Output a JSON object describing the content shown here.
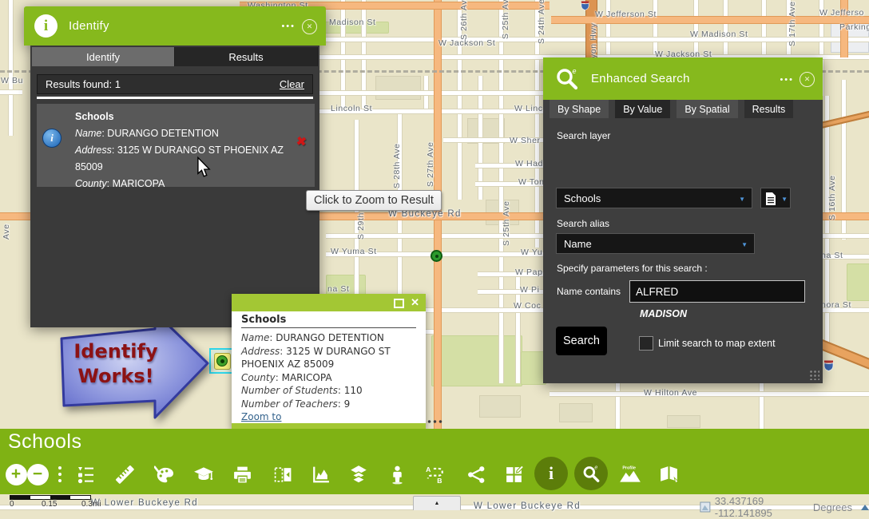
{
  "identify_panel": {
    "title": "Identify",
    "icon_glyph": "i",
    "menu_icon": "•••",
    "close_icon": "✕",
    "tabs": [
      "Identify",
      "Results"
    ],
    "active_tab": "Identify",
    "results_summary": "Results found: 1",
    "clear_label": "Clear",
    "result": {
      "layer": "Schools",
      "remove_icon": "✖",
      "info_glyph": "i",
      "fields": [
        {
          "name": "Name",
          "value": "DURANGO DETENTION"
        },
        {
          "name": "Address",
          "value": "3125 W DURANGO ST PHOENIX AZ 85009"
        },
        {
          "name": "County",
          "value": "MARICOPA"
        }
      ]
    }
  },
  "tooltip": {
    "text": "Click to Zoom to Result"
  },
  "search_panel": {
    "title": "Enhanced Search",
    "icon_superscript": "e",
    "menu_icon": "•••",
    "close_icon": "✕",
    "caret_icon": "▼",
    "tabs": [
      "By Shape",
      "By Value",
      "By Spatial",
      "Results"
    ],
    "active_tab": "By Value",
    "search_layer_label": "Search layer",
    "search_layer_value": "Schools",
    "search_alias_label": "Search alias",
    "search_alias_value": "Name",
    "params_heading": "Specify parameters for this search :",
    "param_label": "Name contains",
    "param_value": "ALFRED",
    "suggestion": "MADISON",
    "search_button": "Search",
    "limit_checkbox_label": "Limit search to map extent",
    "limit_checked": false
  },
  "popup": {
    "title": "Schools",
    "close_icon": "✕",
    "fields": [
      {
        "name": "Name",
        "value": "DURANGO DETENTION"
      },
      {
        "name": "Address",
        "value": "3125 W DURANGO ST PHOENIX AZ 85009"
      },
      {
        "name": "County",
        "value": "MARICOPA"
      },
      {
        "name": "Number of Students",
        "value": "110"
      },
      {
        "name": "Number of Teachers",
        "value": "9"
      }
    ],
    "zoom_link": "Zoom to"
  },
  "annotation": {
    "line1": "Identify",
    "line2": "Works!"
  },
  "bottom_bar": {
    "title": "Schools",
    "zoom_in_glyph": "+",
    "zoom_out_glyph": "−",
    "info_glyph": "i",
    "search_superscript": "e",
    "directions_a": "A",
    "directions_b": "B",
    "profile_icon_label": "Profile",
    "icons": [
      "zoom-in-icon",
      "zoom-out-icon",
      "more-icon",
      "legend-icon",
      "measure-icon",
      "draw-icon",
      "education-icon",
      "print-icon",
      "collapse-panel-icon",
      "chart-icon",
      "layers-icon",
      "streetview-icon",
      "directions-icon",
      "share-icon",
      "basemap-icon",
      "identify-icon",
      "search-icon",
      "profile-icon",
      "edit-flip-icon"
    ],
    "active_icons": [
      "identify-icon",
      "search-icon"
    ]
  },
  "status": {
    "coordinates": "33.437169  -112.141895",
    "units": "Degrees"
  },
  "bottom_tab": {
    "arrow": "▲"
  },
  "scalebar": {
    "start": "0",
    "mid": "0.15",
    "end": "0.3mi"
  },
  "map": {
    "panel_green": "#86b91d",
    "bar_green": "#7fb214",
    "popup_green": "#a3c734",
    "accent_road_color": "#f6b87f",
    "labels": [
      "Washington St",
      "Madison St",
      "W Jackson St",
      "Lincoln St",
      "W Linc",
      "W Jefferson St",
      "W Madison St",
      "W Jackson St",
      "W Jefferso",
      "Parking",
      "W Sher",
      "W Had",
      "W Ton",
      "W Buckeye Rd",
      "W Yuma St",
      "W Yu",
      "W Pap",
      "W Pi",
      "W Coc",
      "na St",
      "W Hilton Ave",
      "na St",
      "nora St",
      "W Lower Buckeye Rd",
      "W Lower Buckeye Rd",
      "W Bu",
      "S 26th Ave",
      "S 25th Ave",
      "S 24th Ave",
      "S 17th Ave",
      "S 28th Ave",
      "S 27th Ave",
      "S 29th",
      "S 25th Ave",
      "S 16th Ave",
      "yon Hwy",
      "Ave"
    ]
  }
}
